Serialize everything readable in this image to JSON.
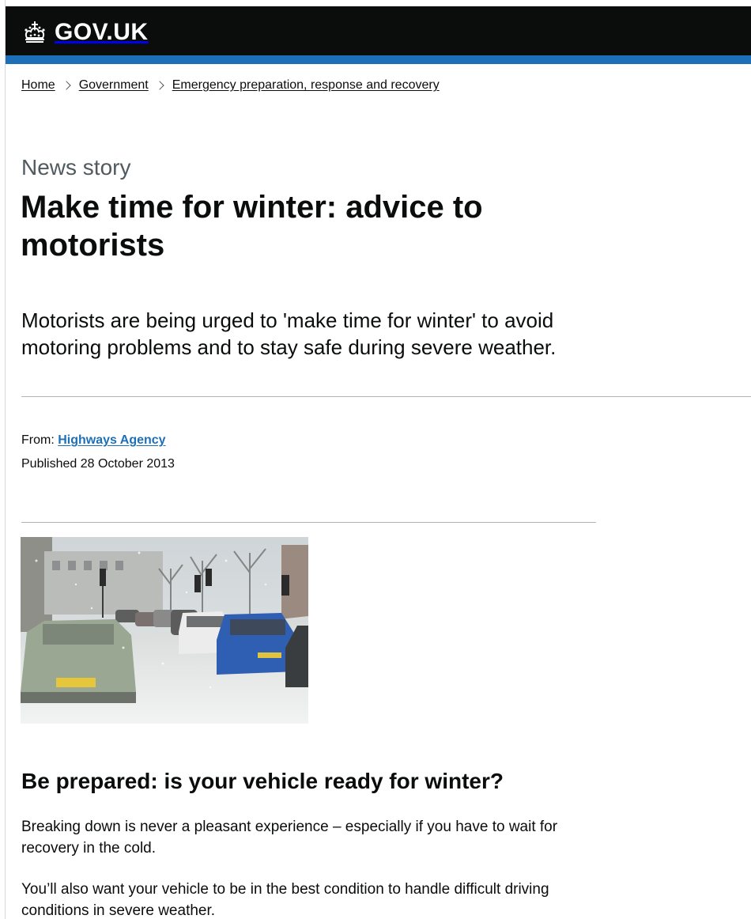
{
  "header": {
    "logo_text": "GOV.UK",
    "logo_icon": "crown-icon",
    "background_color": "#0b0c0c",
    "accent_color": "#1d70b8"
  },
  "breadcrumb": {
    "items": [
      "Home",
      "Government",
      "Emergency preparation, response and recovery"
    ]
  },
  "article": {
    "caption": "News story",
    "title": "Make time for winter: advice to motorists",
    "lead": "Motorists are being urged to 'make time for winter' to avoid motoring problems and to stay safe during severe weather.",
    "from_label": "From:",
    "from_org": "Highways Agency",
    "published_label": "Published",
    "published_date": "28 October 2013",
    "image_subject": "snowy-street-traffic-photo",
    "section_heading": "Be prepared: is your vehicle ready for winter?",
    "paragraphs": [
      "Breaking down is never a pleasant experience – especially if you have to wait for recovery in the cold.",
      "You’ll also want your vehicle to be in the best condition to handle difficult driving conditions in severe weather."
    ]
  }
}
